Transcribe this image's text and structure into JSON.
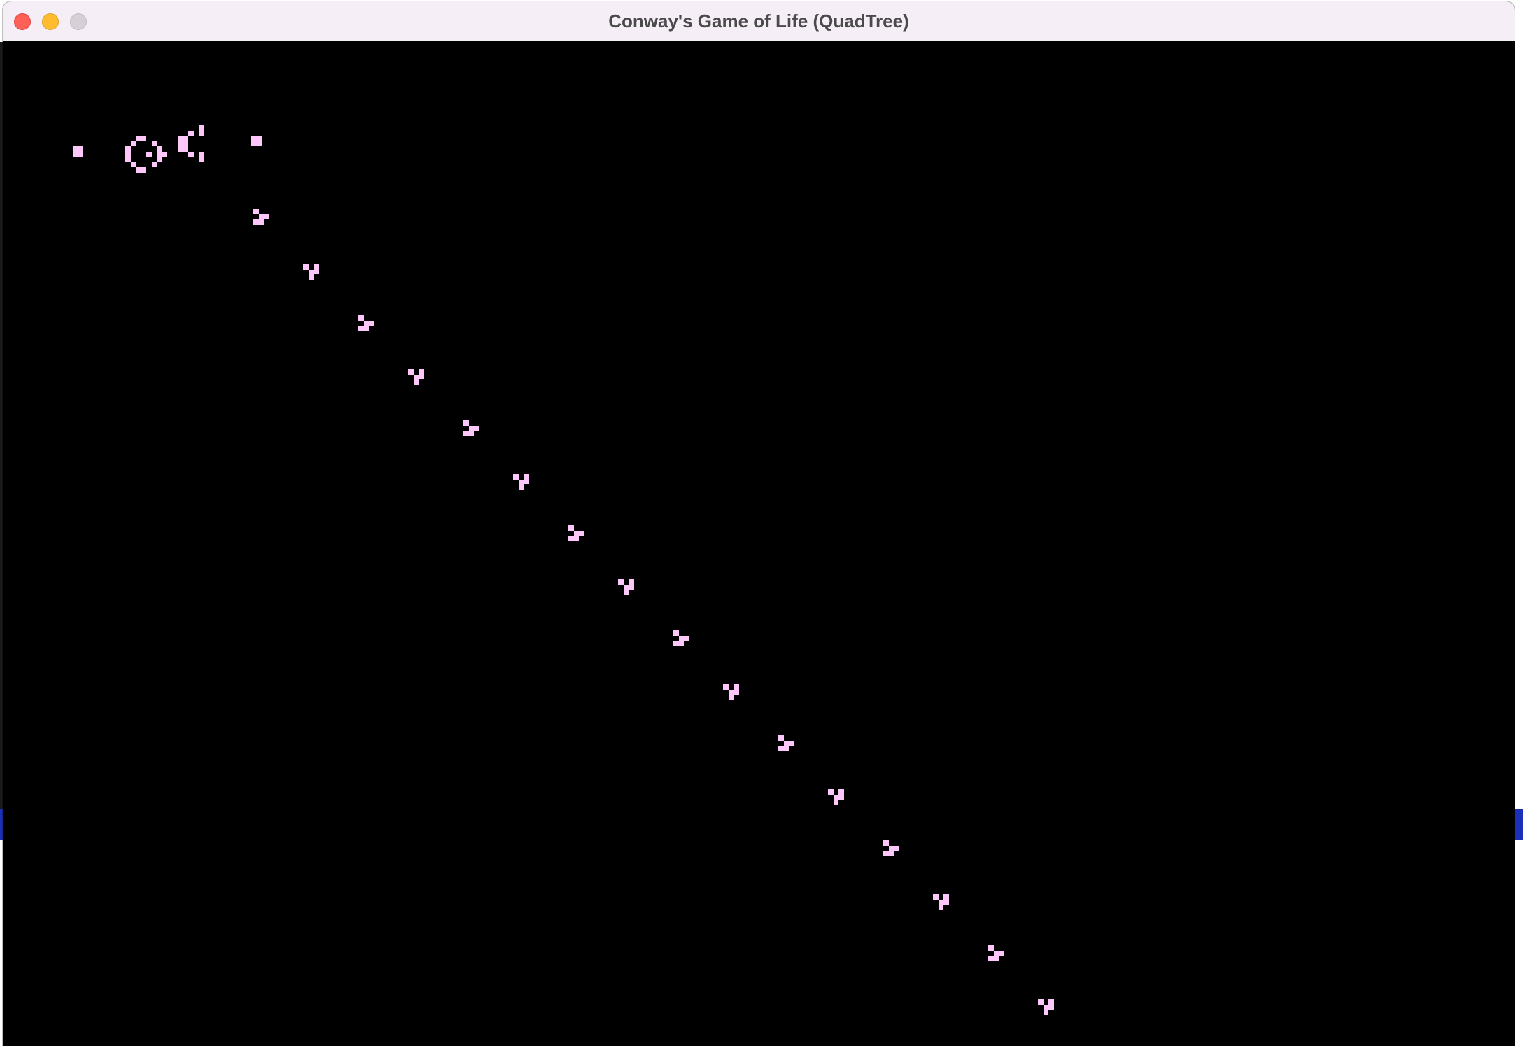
{
  "window": {
    "title": "Conway's Game of Life (QuadTree)"
  },
  "colors": {
    "background": "#000000",
    "live_cell": "#fdc7fa",
    "titlebar": "#f5eef6"
  },
  "icons": {
    "close": "close-traffic-light",
    "minimize": "minimize-traffic-light",
    "zoom": "zoom-traffic-light"
  }
}
